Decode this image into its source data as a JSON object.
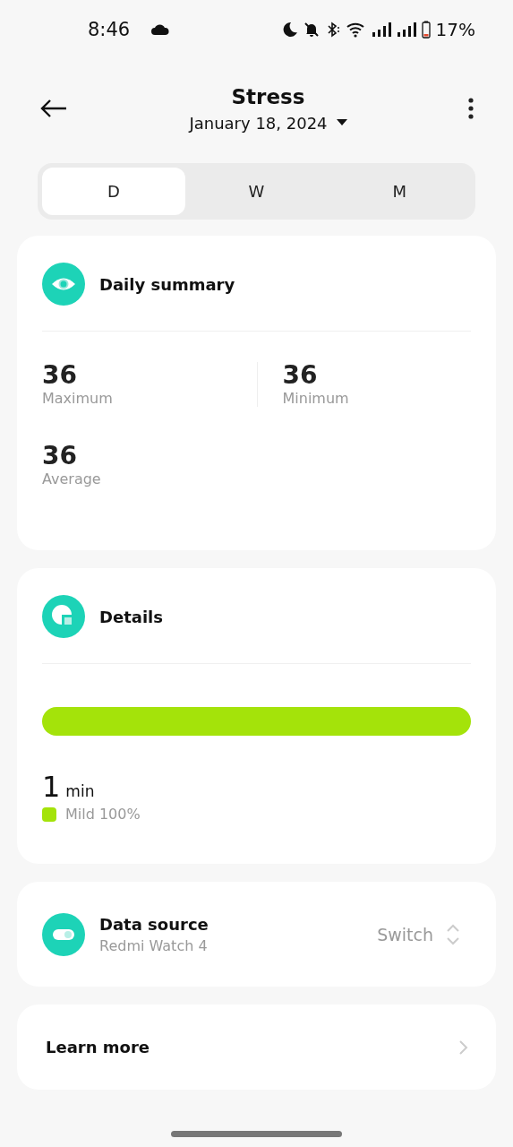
{
  "status_bar": {
    "time": "8:46",
    "battery": "17%"
  },
  "header": {
    "title": "Stress",
    "date": "January 18, 2024"
  },
  "tabs": [
    {
      "label": "D",
      "selected": true
    },
    {
      "label": "W",
      "selected": false
    },
    {
      "label": "M",
      "selected": false
    }
  ],
  "summary": {
    "title": "Daily summary",
    "stats": [
      {
        "value": "36",
        "label": "Maximum"
      },
      {
        "value": "36",
        "label": "Minimum"
      },
      {
        "value": "36",
        "label": "Average"
      }
    ]
  },
  "details": {
    "title": "Details",
    "segments": [
      {
        "label": "Mild 100%",
        "color": "#a4e30a",
        "level": 1
      }
    ],
    "total": "1",
    "unit": "min"
  },
  "data_source": {
    "title": "Data source",
    "device": "Redmi Watch 4",
    "action": "Switch"
  },
  "learn_more": {
    "label": "Learn more"
  }
}
